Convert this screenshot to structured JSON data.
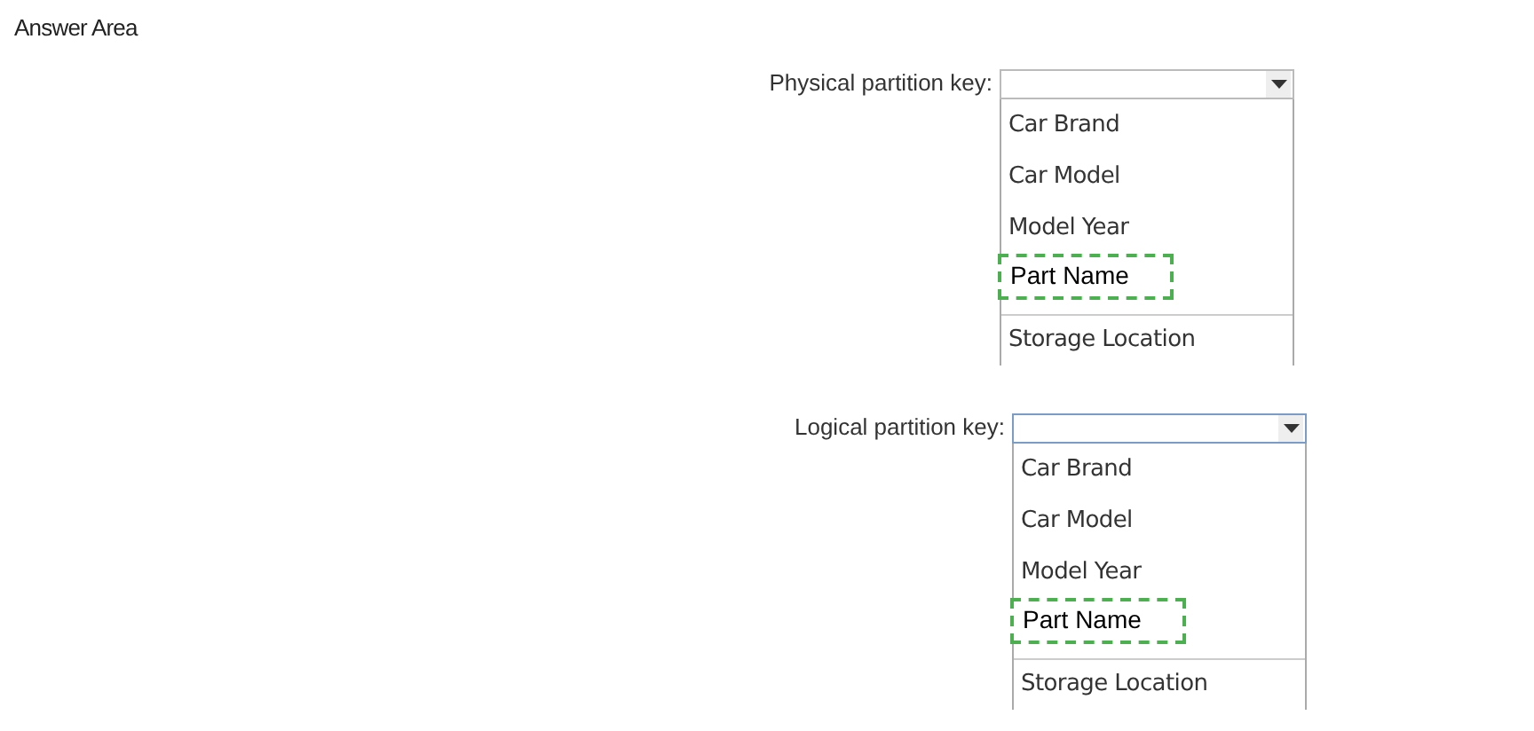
{
  "header": {
    "title": "Answer Area"
  },
  "dropdowns": [
    {
      "label": "Physical partition key:",
      "options": [
        {
          "label": "Car Brand",
          "selected": false
        },
        {
          "label": "Car Model",
          "selected": false
        },
        {
          "label": "Model Year",
          "selected": false
        },
        {
          "label": "Part Name",
          "selected": true
        },
        {
          "label": "Storage Location",
          "selected": false
        }
      ]
    },
    {
      "label": "Logical partition key:",
      "options": [
        {
          "label": "Car Brand",
          "selected": false
        },
        {
          "label": "Car Model",
          "selected": false
        },
        {
          "label": "Model Year",
          "selected": false
        },
        {
          "label": "Part Name",
          "selected": true
        },
        {
          "label": "Storage Location",
          "selected": false
        }
      ]
    }
  ]
}
